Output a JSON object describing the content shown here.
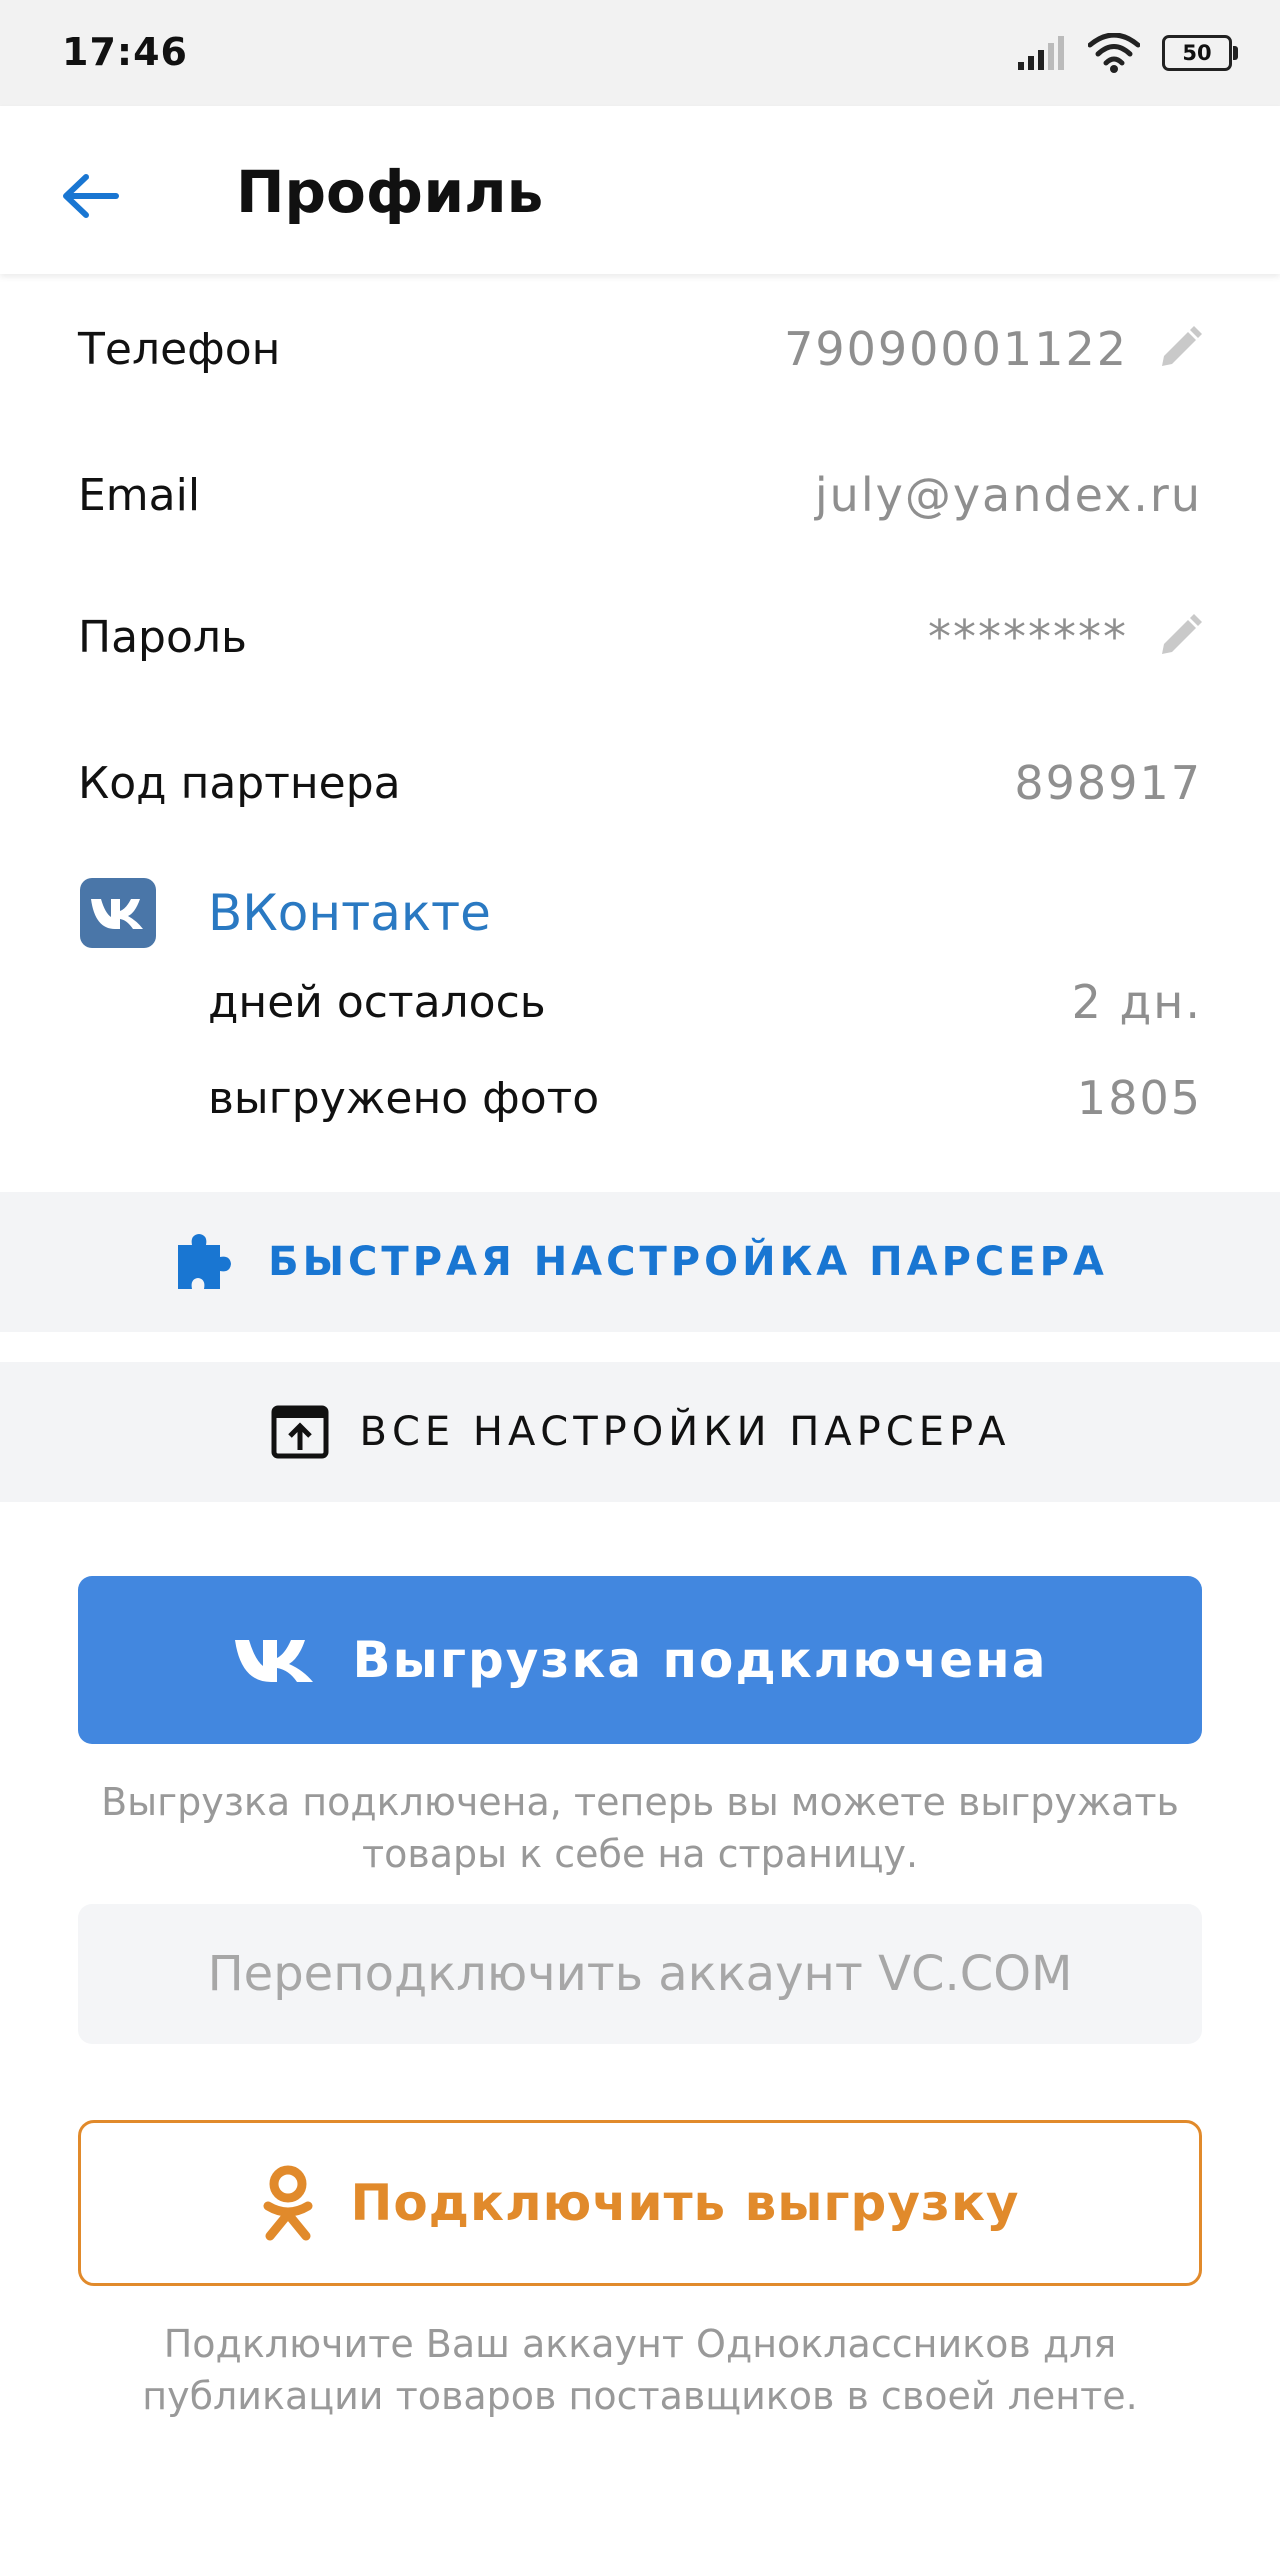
{
  "status_bar": {
    "time": "17:46",
    "battery": "50"
  },
  "header": {
    "title": "Профиль"
  },
  "profile": {
    "phone_label": "Телефон",
    "phone_value": "79090001122",
    "email_label": "Email",
    "email_value": "july@yandex.ru",
    "password_label": "Пароль",
    "password_value": "********",
    "partner_code_label": "Код партнера",
    "partner_code_value": "898917"
  },
  "vk": {
    "title": "ВКонтакте",
    "days_left_label": "дней осталось",
    "days_left_value": "2 дн.",
    "photos_label": "выгружено фото",
    "photos_value": "1805"
  },
  "parser": {
    "quick_setup": "БЫСТРАЯ НАСТРОЙКА ПАРСЕРА",
    "all_settings": "ВСЕ НАСТРОЙКИ ПАРСЕРА"
  },
  "vk_upload": {
    "button_label": "Выгрузка подключена",
    "hint": "Выгрузка подключена, теперь вы можете выгружать товары к себе на страницу.",
    "reconnect_label": "Переподключить аккаунт VC.COM"
  },
  "ok_upload": {
    "button_label": "Подключить выгрузку",
    "hint": "Подключите Ваш аккаунт Одноклассников для публикации товаров поставщиков в своей ленте."
  },
  "colors": {
    "accent_blue": "#4287df",
    "link_blue": "#2a79c2",
    "vk_brand": "#4a76a8",
    "ok_orange": "#e18a2b"
  }
}
